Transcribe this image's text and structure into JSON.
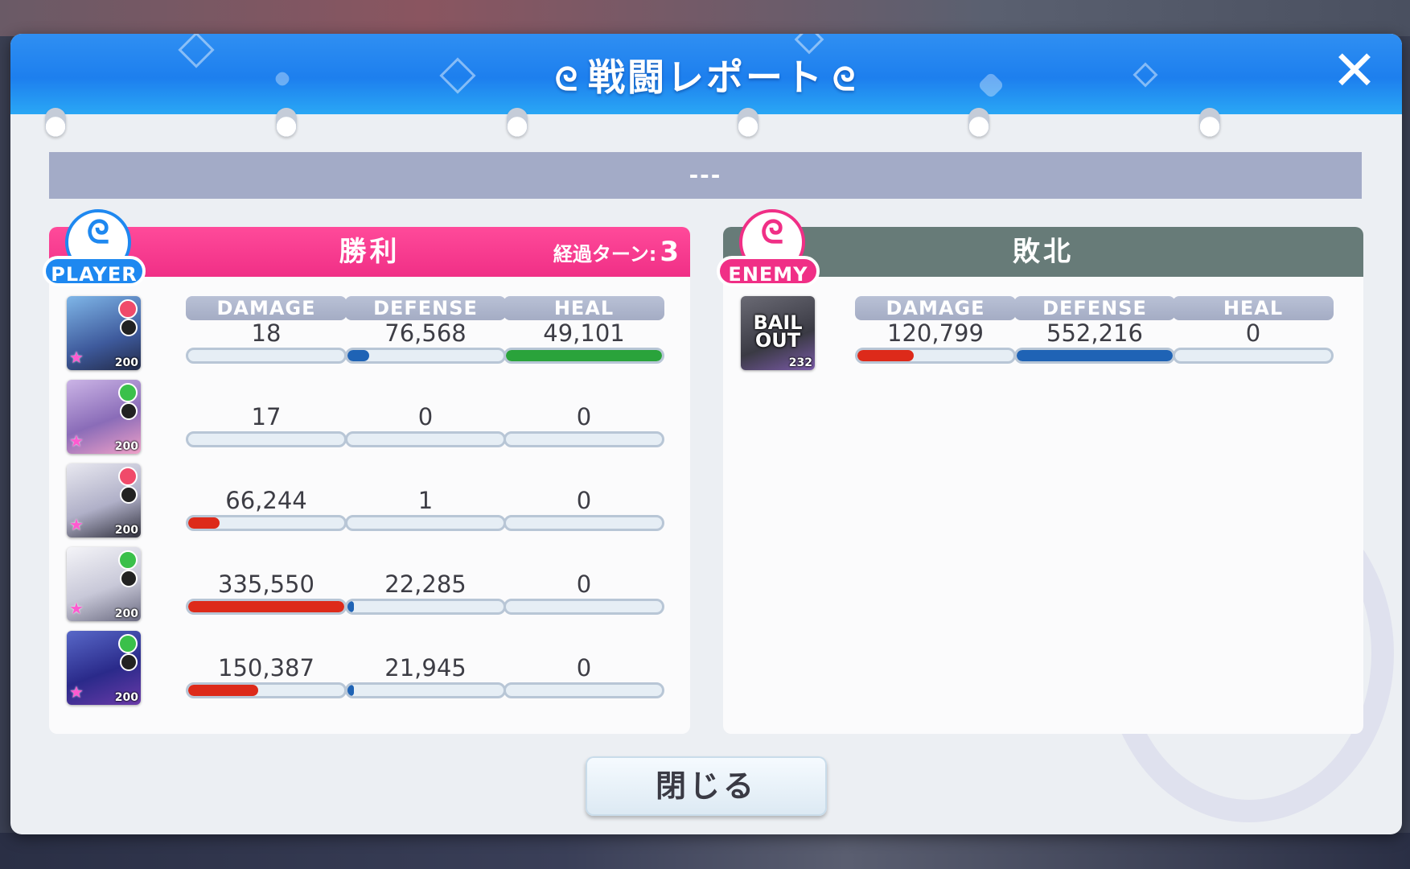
{
  "dialog": {
    "title": "戦闘レポート",
    "message": "---",
    "close_button": "閉じる",
    "close_icon": "close-icon"
  },
  "player": {
    "badge": "PLAYER",
    "result": "勝利",
    "turn_label": "経過ターン:",
    "turns": "3",
    "headers": {
      "damage": "DAMAGE",
      "defense": "DEFENSE",
      "heal": "HEAL"
    },
    "units": [
      {
        "level": "200",
        "damage": "18",
        "defense": "76,568",
        "heal": "49,101",
        "damage_pct": 0.0,
        "defense_pct": 0.14,
        "heal_pct": 1.0
      },
      {
        "level": "200",
        "damage": "17",
        "defense": "0",
        "heal": "0",
        "damage_pct": 0.0,
        "defense_pct": 0.0,
        "heal_pct": 0.0
      },
      {
        "level": "200",
        "damage": "66,244",
        "defense": "1",
        "heal": "0",
        "damage_pct": 0.2,
        "defense_pct": 0.0,
        "heal_pct": 0.0
      },
      {
        "level": "200",
        "damage": "335,550",
        "defense": "22,285",
        "heal": "0",
        "damage_pct": 1.0,
        "defense_pct": 0.04,
        "heal_pct": 0.0
      },
      {
        "level": "200",
        "damage": "150,387",
        "defense": "21,945",
        "heal": "0",
        "damage_pct": 0.45,
        "defense_pct": 0.04,
        "heal_pct": 0.0
      }
    ]
  },
  "enemy": {
    "badge": "ENEMY",
    "result": "敗北",
    "headers": {
      "damage": "DAMAGE",
      "defense": "DEFENSE",
      "heal": "HEAL"
    },
    "units": [
      {
        "name": "BAIL OUT",
        "level": "232",
        "damage": "120,799",
        "defense": "552,216",
        "heal": "0",
        "damage_pct": 0.36,
        "defense_pct": 1.0,
        "heal_pct": 0.0
      }
    ]
  },
  "colors": {
    "damage": "#dd2a1a",
    "defense": "#1f63b5",
    "heal": "#2aa33b",
    "player_accent": "#f02f86",
    "enemy_accent": "#677b78",
    "header_blue": "#1d7fee"
  }
}
